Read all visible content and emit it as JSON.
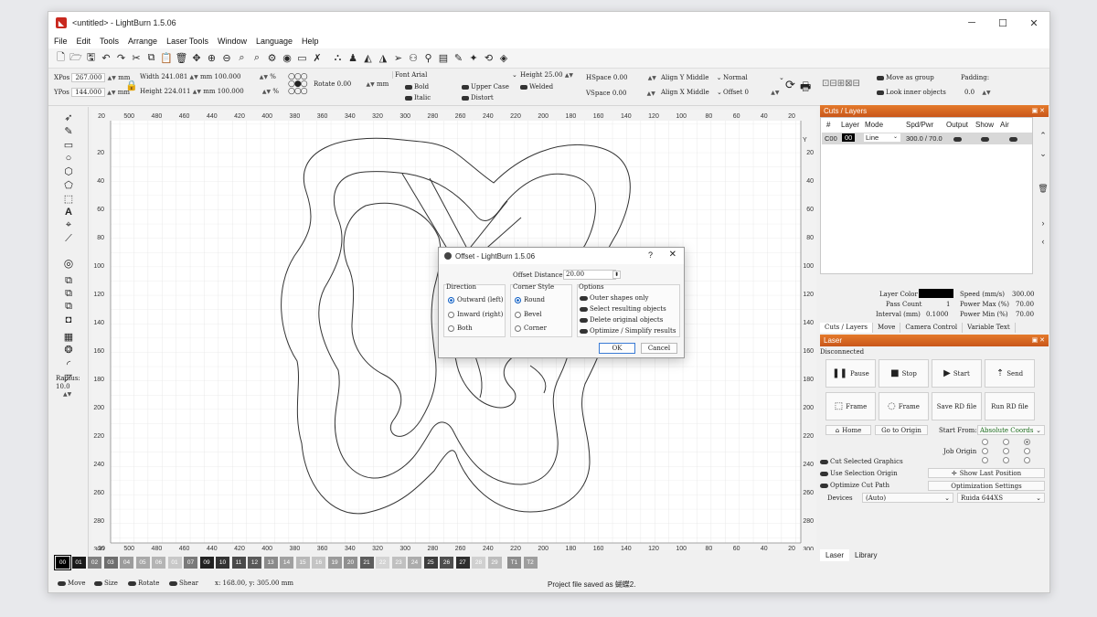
{
  "window": {
    "title": "<untitled> - LightBurn 1.5.06",
    "minimize": "─",
    "maximize": "☐",
    "close": "✕"
  },
  "menu": [
    "File",
    "Edit",
    "Tools",
    "Arrange",
    "Laser Tools",
    "Window",
    "Language",
    "Help"
  ],
  "toolbar_icons": [
    "new-file",
    "open-folder",
    "save",
    "undo",
    "redo",
    "cut",
    "copy",
    "paste",
    "delete",
    "move",
    "zoom-in",
    "zoom-out",
    "zoom-selection",
    "zoom-frame",
    "settings",
    "camera",
    "monitor",
    "tools",
    "group",
    "user",
    "mirror-h",
    "mirror-v",
    "send",
    "circle-array",
    "align",
    "distribute",
    "text-path",
    "node",
    "undo-shape",
    "weld"
  ],
  "props": {
    "xpos_label": "XPos",
    "xpos": "267.000",
    "ypos_label": "YPos",
    "ypos": "144.000",
    "unit": "mm",
    "width_label": "Width",
    "width": "241.081",
    "height_label": "Height",
    "height": "224.011",
    "scale_w": "100.000",
    "scale_h": "100.000",
    "percent": "%",
    "rotate_label": "Rotate",
    "rotate": "0.00",
    "font_label": "Font",
    "font": "Arial",
    "bold": "Bold",
    "italic": "Italic",
    "upper_case": "Upper Case",
    "distort": "Distort",
    "welded": "Welded",
    "text_height_label": "Height",
    "text_height": "25.00",
    "hspace_label": "HSpace",
    "hspace": "0.00",
    "vspace_label": "VSpace",
    "vspace": "0.00",
    "align_y_label": "Align Y",
    "align_y": "Middle",
    "align_x_label": "Align X",
    "align_x": "Middle",
    "normal": "Normal",
    "offset_label": "Offset",
    "offset": "0",
    "move_as_group": "Move as group",
    "look_inner": "Look inner objects",
    "padding_label": "Padding:",
    "padding": "0.0"
  },
  "left_tools": [
    "select-arrow",
    "pen-edit",
    "rectangle",
    "ellipse",
    "polygon",
    "pentagon",
    "rect-dash",
    "text",
    "position-marker",
    "measure",
    "offset-ring",
    "boolean-union",
    "boolean-subtract",
    "boolean-intersect",
    "weld-small",
    "grid-array",
    "circular-array",
    "round-corner",
    "chamfer"
  ],
  "radius": {
    "label": "Radius:",
    "value": "10.0"
  },
  "canvas": {
    "top_ruler": [
      "20",
      "500",
      "480",
      "460",
      "440",
      "420",
      "400",
      "380",
      "360",
      "340",
      "320",
      "300",
      "280",
      "260",
      "240",
      "220",
      "200",
      "180",
      "160",
      "140",
      "120",
      "100",
      "80",
      "60",
      "40",
      "20",
      "0"
    ],
    "bottom_ruler": [
      "20",
      "500",
      "480",
      "460",
      "440",
      "420",
      "400",
      "380",
      "360",
      "340",
      "320",
      "300",
      "280",
      "260",
      "240",
      "220",
      "200",
      "180",
      "160",
      "140",
      "120",
      "100",
      "80",
      "60",
      "40",
      "20",
      "0"
    ],
    "left_ruler": [
      "20",
      "40",
      "60",
      "80",
      "100",
      "120",
      "140",
      "160",
      "180",
      "200",
      "220",
      "240",
      "260",
      "280",
      "300"
    ],
    "right_ruler": [
      "20",
      "40",
      "60",
      "80",
      "100",
      "120",
      "140",
      "160",
      "180",
      "200",
      "220",
      "240",
      "260",
      "280",
      "300"
    ],
    "y_axis_label": "Y"
  },
  "palette": [
    {
      "label": "00",
      "color": "#000000"
    },
    {
      "label": "01",
      "color": "#1a1a1a"
    },
    {
      "label": "02",
      "color": "#808080"
    },
    {
      "label": "03",
      "color": "#6e6e6e"
    },
    {
      "label": "04",
      "color": "#9c9c9c"
    },
    {
      "label": "05",
      "color": "#a8a8a8"
    },
    {
      "label": "06",
      "color": "#b4b4b4"
    },
    {
      "label": "01",
      "color": "#c8c8c8"
    },
    {
      "label": "07",
      "color": "#7a7a7a"
    },
    {
      "label": "09",
      "color": "#222222"
    },
    {
      "label": "10",
      "color": "#333333"
    },
    {
      "label": "11",
      "color": "#4a4a4a"
    },
    {
      "label": "12",
      "color": "#5a5a5a"
    },
    {
      "label": "13",
      "color": "#8a8a8a"
    },
    {
      "label": "14",
      "color": "#a0a0a0"
    },
    {
      "label": "15",
      "color": "#b8b8b8"
    },
    {
      "label": "16",
      "color": "#c4c4c4"
    },
    {
      "label": "19",
      "color": "#9a9a9a"
    },
    {
      "label": "20",
      "color": "#909090"
    },
    {
      "label": "21",
      "color": "#5c5c5c"
    },
    {
      "label": "22",
      "color": "#d4d4d4"
    },
    {
      "label": "23",
      "color": "#c0c0c0"
    },
    {
      "label": "24",
      "color": "#acacac"
    },
    {
      "label": "25",
      "color": "#3c3c3c"
    },
    {
      "label": "26",
      "color": "#4e4e4e"
    },
    {
      "label": "27",
      "color": "#2e2e2e"
    },
    {
      "label": "28",
      "color": "#d0d0d0"
    },
    {
      "label": "29",
      "color": "#bcbcbc"
    },
    {
      "label": "T1",
      "color": "#8c8c8c"
    },
    {
      "label": "T2",
      "color": "#9e9e9e"
    }
  ],
  "status": {
    "move": "Move",
    "size": "Size",
    "rotate": "Rotate",
    "shear": "Shear",
    "coords": "x: 168.00, y: 305.00 mm",
    "message": "Project file saved as 蝴蝶2."
  },
  "cuts": {
    "title": "Cuts / Layers",
    "headers": [
      "#",
      "Layer",
      "Mode",
      "Spd/Pwr",
      "Output",
      "Show",
      "Air"
    ],
    "row": {
      "num": "C00",
      "layer": "00",
      "mode": "Line",
      "spdpwr": "300.0 / 70.0"
    },
    "layer_color_label": "Layer Color",
    "speed_label": "Speed (mm/s)",
    "speed": "300.00",
    "pass_count_label": "Pass Count",
    "pass_count": "1",
    "power_max_label": "Power Max (%)",
    "power_max": "70.00",
    "interval_label": "Interval (mm)",
    "interval": "0.1000",
    "power_min_label": "Power Min (%)",
    "power_min": "70.00",
    "tabs": [
      "Cuts / Layers",
      "Move",
      "Camera Control",
      "Variable Text"
    ]
  },
  "laser": {
    "title": "Laser",
    "state": "Disconnected",
    "pause": "Pause",
    "stop": "Stop",
    "start": "Start",
    "send": "Send",
    "frame1": "Frame",
    "frame2": "Frame",
    "save_rd": "Save RD file",
    "run_rd": "Run RD file",
    "home": "Home",
    "go_origin": "Go to Origin",
    "start_from_label": "Start From:",
    "start_from": "Absolute Coords",
    "job_origin_label": "Job Origin",
    "cut_selected": "Cut Selected Graphics",
    "use_selection_origin": "Use Selection Origin",
    "optimize_cut_path": "Optimize Cut Path",
    "show_last_position": "Show Last Position",
    "optimization_settings": "Optimization Settings",
    "devices_label": "Devices",
    "devices": "(Auto)",
    "controller": "Ruida 644XS",
    "bottom_tabs": [
      "Laser",
      "Library"
    ]
  },
  "dialog": {
    "title": "Offset - LightBurn 1.5.06",
    "help": "?",
    "close": "✕",
    "offset_distance_label": "Offset Distance",
    "offset_distance": "20.00",
    "direction_title": "Direction",
    "direction_options": [
      "Outward (left)",
      "Inward (right)",
      "Both"
    ],
    "corner_title": "Corner Style",
    "corner_options": [
      "Round",
      "Bevel",
      "Corner"
    ],
    "options_title": "Options",
    "options": [
      "Outer shapes only",
      "Select resulting objects",
      "Delete original objects",
      "Optimize / Simplify results"
    ],
    "ok": "OK",
    "cancel": "Cancel"
  }
}
